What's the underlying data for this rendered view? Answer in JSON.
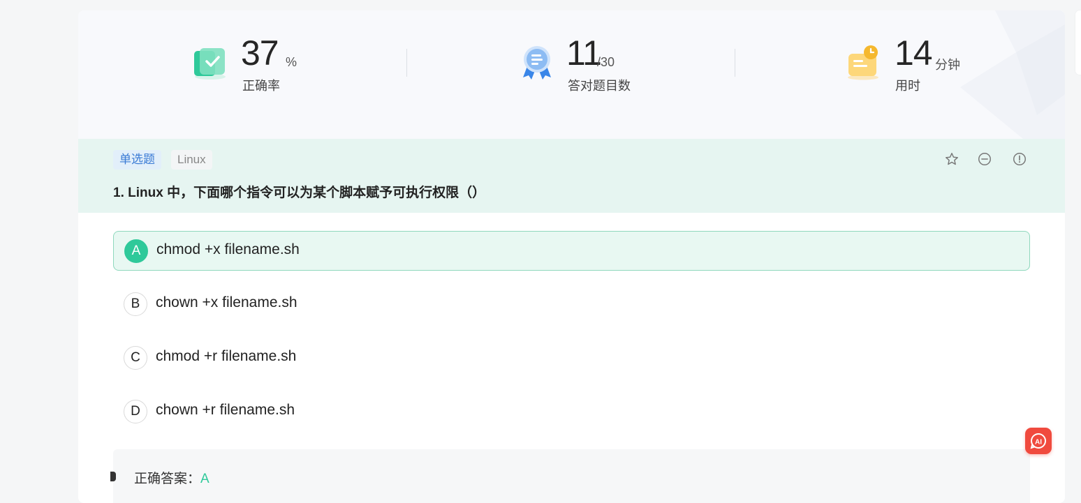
{
  "stats": [
    {
      "value": "37",
      "unit": "%",
      "label": "正确率",
      "icon": "accuracy-book-check-icon"
    },
    {
      "value": "11",
      "unit": "/30",
      "label": "答对题目数",
      "icon": "award-medal-icon"
    },
    {
      "value": "14",
      "unit": "分钟",
      "label": "用时",
      "icon": "clock-note-icon"
    }
  ],
  "question": {
    "type_tag": "单选题",
    "subject_tag": "Linux",
    "title": "1. Linux 中，下面哪个指令可以为某个脚本赋予可执行权限（）",
    "actions": [
      "star-icon",
      "minus-circle-icon",
      "exclamation-circle-icon"
    ],
    "options": [
      {
        "letter": "A",
        "text": "chmod +x filename.sh",
        "selected": true
      },
      {
        "letter": "B",
        "text": "chown +x filename.sh",
        "selected": false
      },
      {
        "letter": "C",
        "text": "chmod +r filename.sh",
        "selected": false
      },
      {
        "letter": "D",
        "text": "chown +r filename.sh",
        "selected": false
      }
    ]
  },
  "answer": {
    "label": "正确答案：",
    "value": "A"
  },
  "ai_button": {
    "icon": "ai-assistant-icon"
  },
  "colors": {
    "accent_green": "#2fc99a",
    "header_bg": "#e6f5f1",
    "tag_blue": "#3a7bd5",
    "ai_red": "#f04a3e"
  }
}
